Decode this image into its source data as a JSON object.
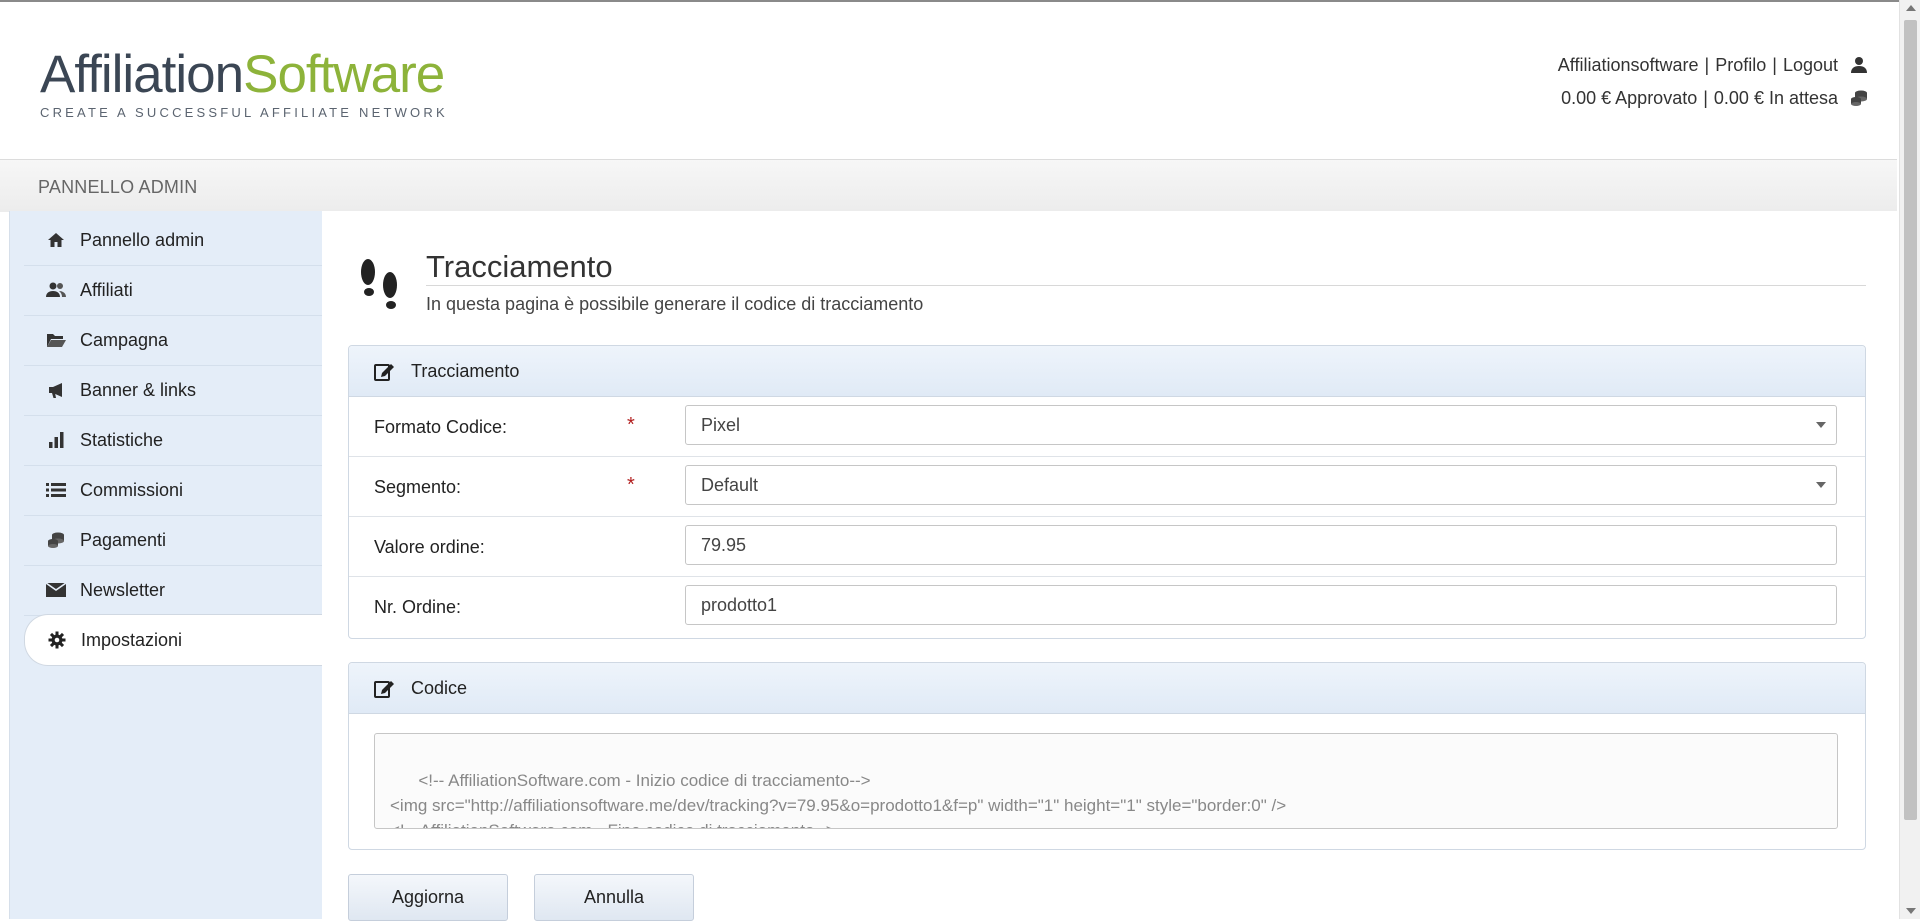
{
  "logo": {
    "part1": "Affiliation",
    "part2": "Software",
    "tagline": "CREATE A SUCCESSFUL AFFILIATE NETWORK",
    "colors": {
      "primary": "#3b4654",
      "accent": "#8db33a"
    }
  },
  "user_menu": {
    "username": "Affiliationsoftware",
    "profile": "Profilo",
    "logout": "Logout",
    "separator": "|",
    "user_icon": "user-icon",
    "approved": "0.00 € Approvato",
    "pending": "0.00 € In attesa",
    "coins_icon": "coins-icon"
  },
  "adminbar": {
    "title": "PANNELLO ADMIN"
  },
  "sidebar": {
    "items": [
      {
        "label": "Pannello admin",
        "icon": "home-icon"
      },
      {
        "label": "Affiliati",
        "icon": "users-icon"
      },
      {
        "label": "Campagna",
        "icon": "folder-open-icon"
      },
      {
        "label": "Banner & links",
        "icon": "megaphone-icon"
      },
      {
        "label": "Statistiche",
        "icon": "bar-chart-icon"
      },
      {
        "label": "Commissioni",
        "icon": "list-icon"
      },
      {
        "label": "Pagamenti",
        "icon": "coins-icon"
      },
      {
        "label": "Newsletter",
        "icon": "envelope-icon"
      },
      {
        "label": "Impostazioni",
        "icon": "gear-icon",
        "active": true
      }
    ]
  },
  "page": {
    "title": "Tracciamento",
    "subtitle": "In questa pagina è possibile generare il codice di tracciamento",
    "icon": "footprints-icon"
  },
  "tracking_panel": {
    "title": "Tracciamento",
    "icon": "edit-icon",
    "fields": {
      "format": {
        "label": "Formato Codice:",
        "required": "*",
        "value": "Pixel"
      },
      "segment": {
        "label": "Segmento:",
        "required": "*",
        "value": "Default"
      },
      "order_value": {
        "label": "Valore ordine:",
        "value": "79.95"
      },
      "order_nr": {
        "label": "Nr. Ordine:",
        "value": "prodotto1"
      }
    }
  },
  "code_panel": {
    "title": "Codice",
    "icon": "edit-icon",
    "code": "<!-- AffiliationSoftware.com - Inizio codice di tracciamento-->\n<img src=\"http://affiliationsoftware.me/dev/tracking?v=79.95&o=prodotto1&f=p\" width=\"1\" height=\"1\" style=\"border:0\" />\n<!-- AffiliationSoftware.com - Fine codice di tracciamento-->"
  },
  "buttons": {
    "update": "Aggiorna",
    "cancel": "Annulla"
  }
}
